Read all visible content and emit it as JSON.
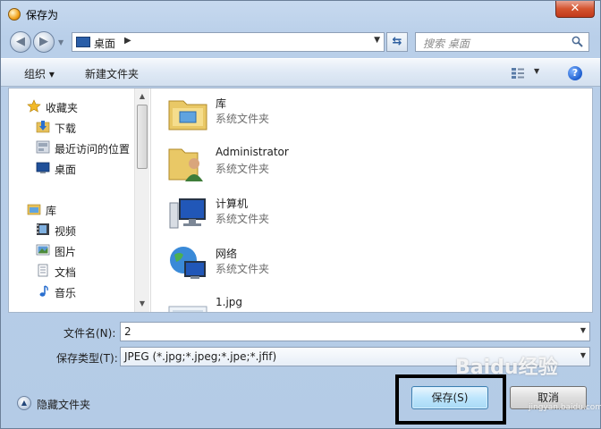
{
  "window": {
    "title": "保存为",
    "close_label": "✕"
  },
  "nav": {
    "address": "桌面",
    "search_placeholder": "搜索 桌面"
  },
  "toolbar": {
    "organize_label": "组织 ▾",
    "new_folder_label": "新建文件夹"
  },
  "sidebar": {
    "items": [
      {
        "label": "收藏夹",
        "icon": "star-icon"
      },
      {
        "label": "下载",
        "icon": "download-folder-icon"
      },
      {
        "label": "最近访问的位置",
        "icon": "recent-places-icon"
      },
      {
        "label": "桌面",
        "icon": "desktop-icon"
      },
      {
        "label": "库",
        "icon": "library-icon"
      },
      {
        "label": "视频",
        "icon": "video-library-icon"
      },
      {
        "label": "图片",
        "icon": "pictures-library-icon"
      },
      {
        "label": "文档",
        "icon": "documents-library-icon"
      },
      {
        "label": "音乐",
        "icon": "music-icon"
      }
    ]
  },
  "files": [
    {
      "name": "库",
      "type": "系统文件夹",
      "icon": "library-folder-icon"
    },
    {
      "name": "Administrator",
      "type": "系统文件夹",
      "icon": "user-folder-icon"
    },
    {
      "name": "计算机",
      "type": "系统文件夹",
      "icon": "computer-icon"
    },
    {
      "name": "网络",
      "type": "系统文件夹",
      "icon": "network-icon"
    },
    {
      "name": "1.jpg",
      "type": "",
      "icon": "image-file-icon"
    }
  ],
  "form": {
    "filename_label": "文件名(N):",
    "filename_value": "2",
    "filetype_label": "保存类型(T):",
    "filetype_value": "JPEG (*.jpg;*.jpeg;*.jpe;*.jfif)"
  },
  "footer": {
    "hide_folders_label": "隐藏文件夹",
    "save_label": "保存(S)",
    "cancel_label": "取消"
  },
  "watermark": {
    "text": "Baidu经验",
    "sub": "jingyan.baidu.com"
  }
}
